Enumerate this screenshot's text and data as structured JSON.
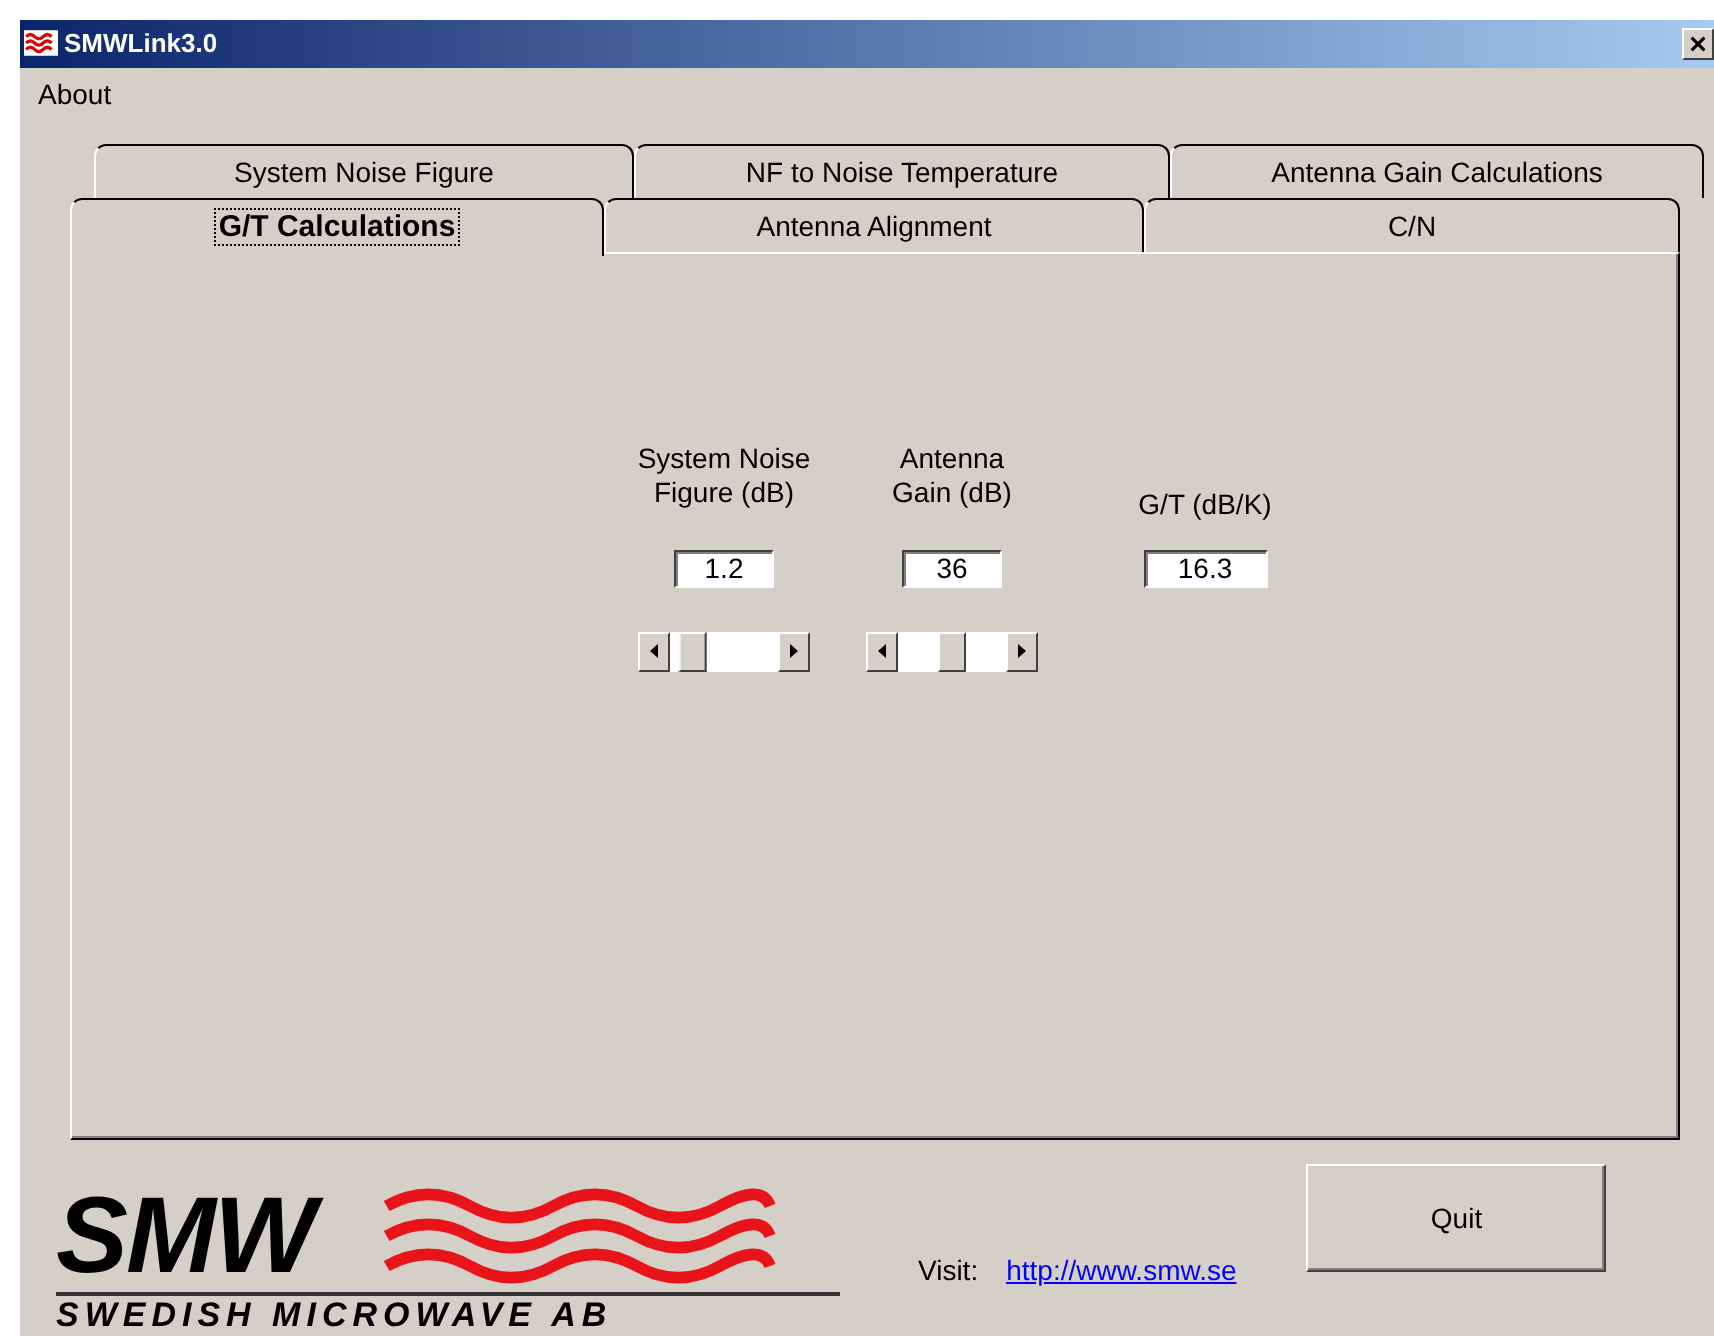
{
  "window": {
    "title": "SMWLink3.0"
  },
  "menu": [
    "About"
  ],
  "tab_rows": [
    [
      {
        "label": "System Noise Figure",
        "selected": false
      },
      {
        "label": "NF to Noise Temperature",
        "selected": false
      },
      {
        "label": "Antenna Gain Calculations",
        "selected": false
      }
    ],
    [
      {
        "label": "G/T Calculations",
        "selected": true
      },
      {
        "label": "Antenna Alignment",
        "selected": false
      },
      {
        "label": "C/N",
        "selected": false
      }
    ]
  ],
  "fields": [
    {
      "label": "System Noise Figure (dB)",
      "value": "1.2",
      "kind": "slider",
      "level": 0.12
    },
    {
      "label": "Antenna Gain (dB)",
      "value": "36",
      "kind": "slider",
      "level": 0.5
    },
    {
      "label": "G/T (dB/K)",
      "value": "16.3",
      "kind": "result"
    }
  ],
  "logo": {
    "name": "SMW",
    "tagline": "SWEDISH MICROWAVE AB"
  },
  "visit": {
    "label": "Visit:",
    "link": "http://www.smw.se"
  },
  "quit_button": "Quit"
}
